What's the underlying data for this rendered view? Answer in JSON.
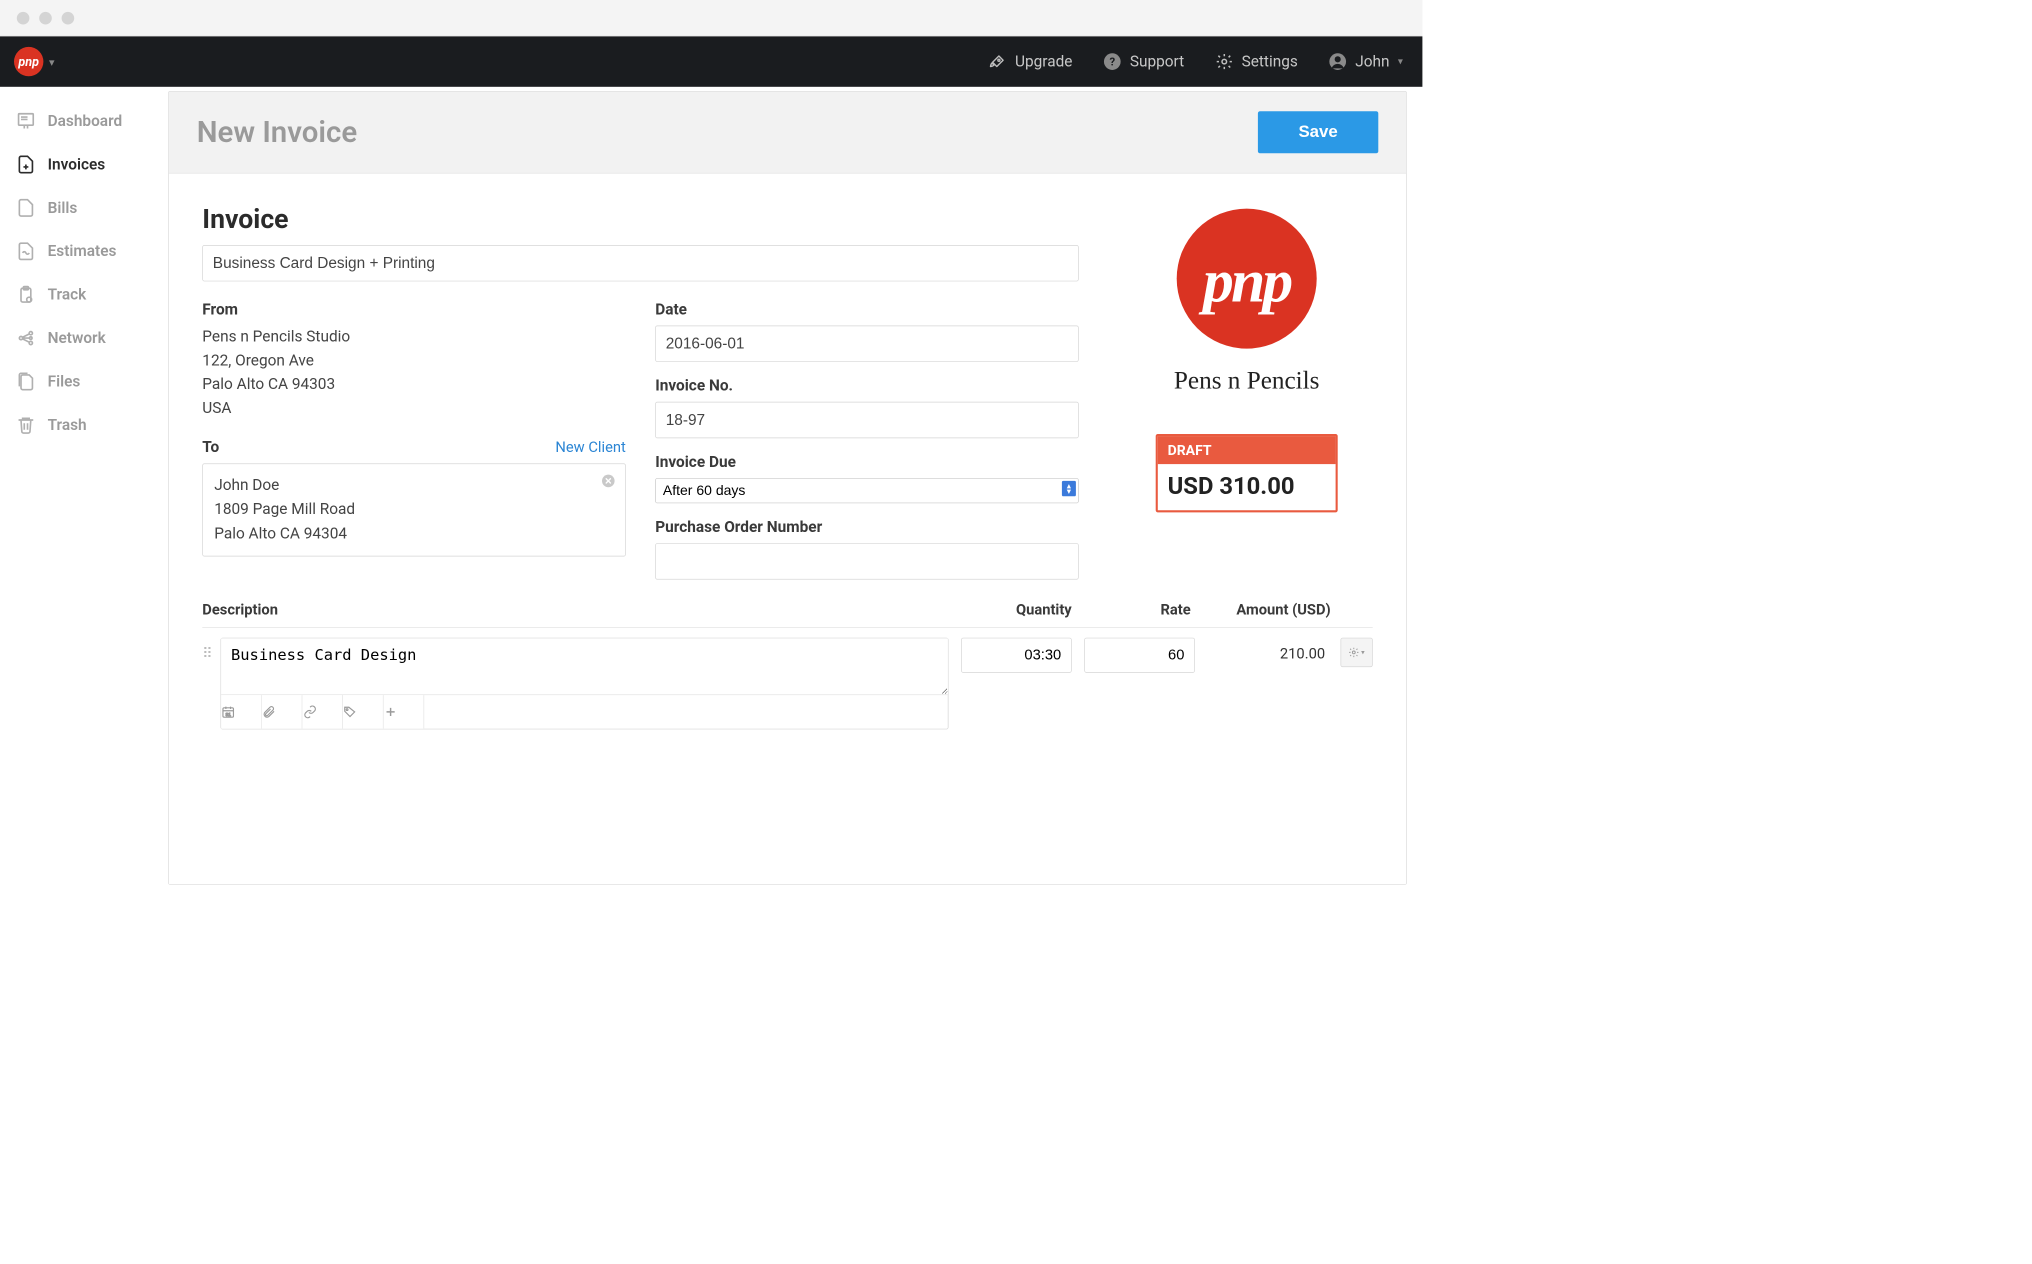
{
  "topbar": {
    "upgrade": "Upgrade",
    "support": "Support",
    "settings": "Settings",
    "user": "John"
  },
  "sidebar": {
    "items": [
      {
        "label": "Dashboard"
      },
      {
        "label": "Invoices"
      },
      {
        "label": "Bills"
      },
      {
        "label": "Estimates"
      },
      {
        "label": "Track"
      },
      {
        "label": "Network"
      },
      {
        "label": "Files"
      },
      {
        "label": "Trash"
      }
    ]
  },
  "page": {
    "title": "New Invoice",
    "save": "Save",
    "section_title": "Invoice",
    "invoice_title_value": "Business Card Design + Printing"
  },
  "from": {
    "label": "From",
    "name": "Pens n Pencils Studio",
    "street": "122, Oregon Ave",
    "city": "Palo Alto CA 94303",
    "country": "USA"
  },
  "to": {
    "label": "To",
    "new_client": "New Client",
    "name": "John Doe",
    "street": "1809 Page Mill Road",
    "city": "Palo Alto CA 94304"
  },
  "meta": {
    "date_label": "Date",
    "date": "2016-06-01",
    "invoice_no_label": "Invoice No.",
    "invoice_no": "18-97",
    "due_label": "Invoice Due",
    "due_option": "After 60 days",
    "po_label": "Purchase Order Number",
    "po_value": ""
  },
  "brand_panel": {
    "logo_text": "pnp",
    "company": "Pens n Pencils",
    "status": "DRAFT",
    "total": "USD 310.00"
  },
  "line_items": {
    "headers": {
      "desc": "Description",
      "qty": "Quantity",
      "rate": "Rate",
      "amount": "Amount (USD)"
    },
    "rows": [
      {
        "desc": "Business Card Design",
        "qty": "03:30",
        "rate": "60",
        "amount": "210.00"
      }
    ]
  }
}
